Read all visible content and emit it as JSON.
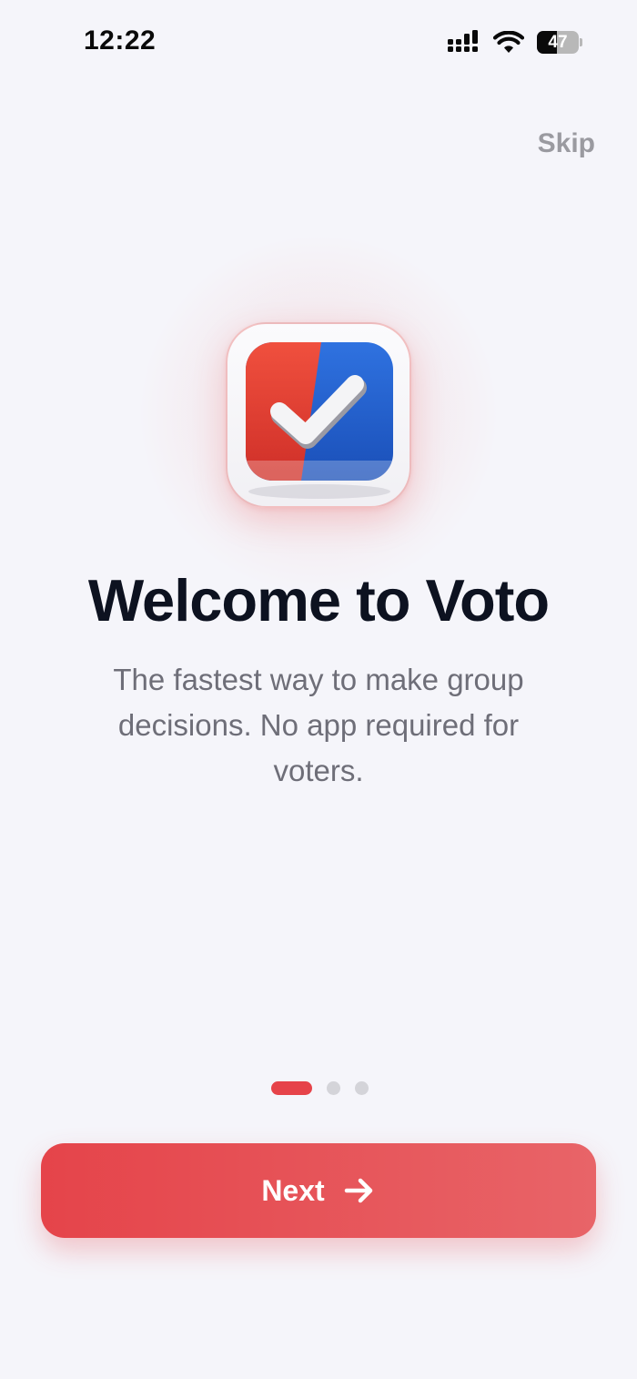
{
  "status_bar": {
    "time": "12:22",
    "battery_percent": "47",
    "battery_level": 0.47
  },
  "header": {
    "skip_label": "Skip"
  },
  "onboarding": {
    "title": "Welcome to Voto",
    "subtitle": "The fastest way to make group decisions. No app required for voters.",
    "app_icon": "ballot-check-icon",
    "current_page": 1,
    "total_pages": 3
  },
  "footer": {
    "next_label": "Next",
    "next_icon": "arrow-right-icon"
  },
  "colors": {
    "accent": "#e64349",
    "background": "#f5f5fa",
    "icon_red": "#e8463a",
    "icon_blue": "#1f5fd0"
  }
}
